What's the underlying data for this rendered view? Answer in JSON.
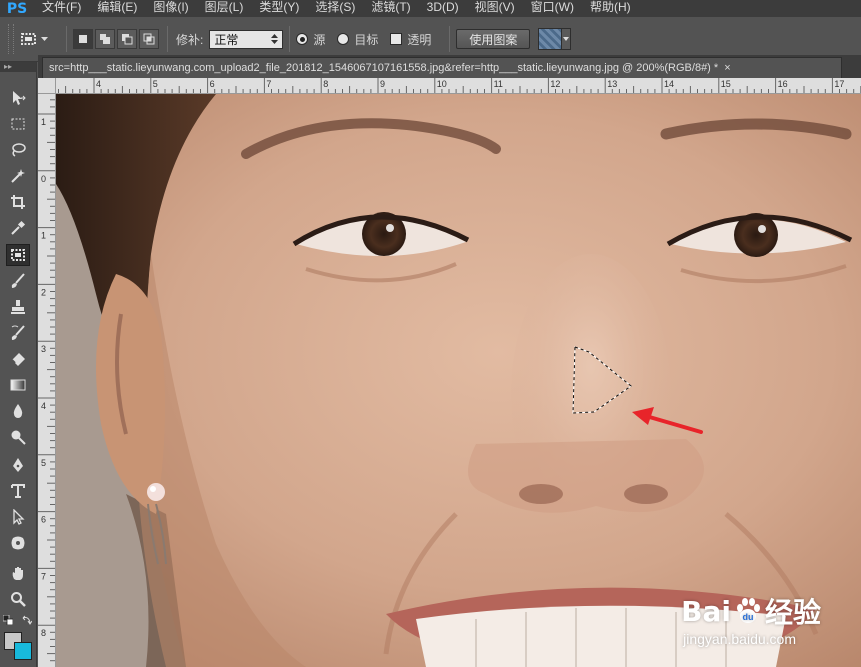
{
  "app": {
    "logo": "PS"
  },
  "menu": [
    "文件(F)",
    "编辑(E)",
    "图像(I)",
    "图层(L)",
    "类型(Y)",
    "选择(S)",
    "滤镜(T)",
    "3D(D)",
    "视图(V)",
    "窗口(W)",
    "帮助(H)"
  ],
  "options": {
    "patch_label": "修补:",
    "patch_mode": "正常",
    "source_label": "源",
    "target_label": "目标",
    "transparent_label": "透明",
    "use_pattern_label": "使用图案"
  },
  "document": {
    "tab_title": "src=http___static.lieyunwang.com_upload2_file_201812_1546067107161558.jpg&refer=http___static.lieyunwang.jpg @ 200%(RGB/8#) *",
    "close_glyph": "×"
  },
  "rulers": {
    "horizontal_labels": [
      "4",
      "5",
      "6",
      "7",
      "8",
      "9",
      "10",
      "11",
      "12",
      "13",
      "14",
      "15",
      "16",
      "17"
    ],
    "vertical_labels": [
      "1",
      "0",
      "1",
      "2",
      "3",
      "4",
      "5",
      "6",
      "7",
      "8",
      "9"
    ]
  },
  "watermark": {
    "brand_left": "Bai",
    "brand_right": "经验",
    "url": "jingyan.baidu.com"
  },
  "colors": {
    "foreground": "#c8c8c8",
    "background": "#18b9dc",
    "accent_arrow": "#e8242a"
  }
}
